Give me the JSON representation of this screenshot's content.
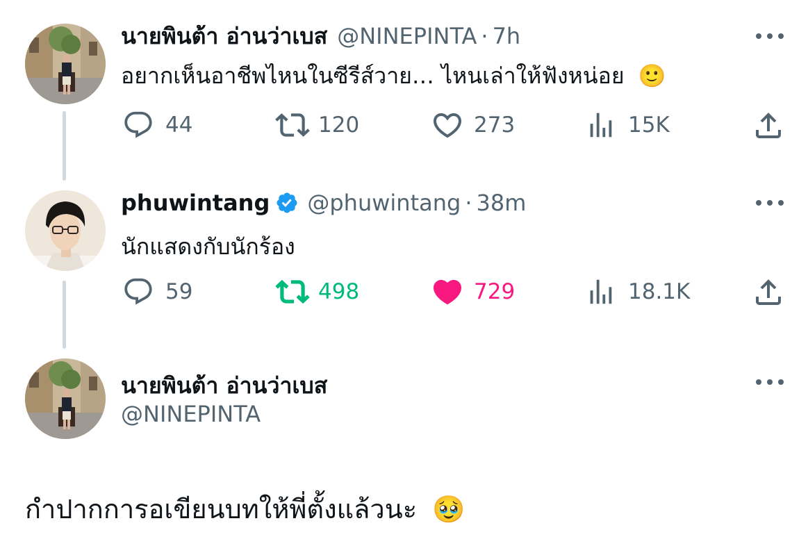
{
  "tweets": [
    {
      "name": "นายพินต้า อ่านว่าเบส",
      "handle": "@NINEPINTA",
      "separator": "·",
      "time": "7h",
      "text": "อยากเห็นอาชีพไหนในซีรีส์วาย… ไหนเล่าให้ฟังหน่อย",
      "emoji": "🙂",
      "replies": "44",
      "retweets": "120",
      "likes": "273",
      "views": "15K",
      "retweeted": false,
      "liked": false
    },
    {
      "name": "phuwintang",
      "handle": "@phuwintang",
      "separator": "·",
      "time": "38m",
      "text": "นักแสดงกับนักร้อง",
      "verified": true,
      "replies": "59",
      "retweets": "498",
      "likes": "729",
      "views": "18.1K",
      "retweeted": true,
      "liked": true
    }
  ],
  "focused_tweet": {
    "name": "นายพินต้า อ่านว่าเบส",
    "handle": "@NINEPINTA",
    "text": "กำปากการอเขียนบทให้พี่ตั้งแล้วนะ",
    "emoji": "🥹"
  },
  "colors": {
    "text_primary": "#0f1419",
    "text_secondary": "#536471",
    "retweet_active": "#00ba7c",
    "like_active": "#f91880",
    "verified_badge": "#1d9bf0",
    "thread_line": "#cfd9de"
  },
  "icons": [
    "reply-icon",
    "retweet-icon",
    "like-icon",
    "views-icon",
    "share-icon",
    "more-icon",
    "verified-badge-icon"
  ]
}
